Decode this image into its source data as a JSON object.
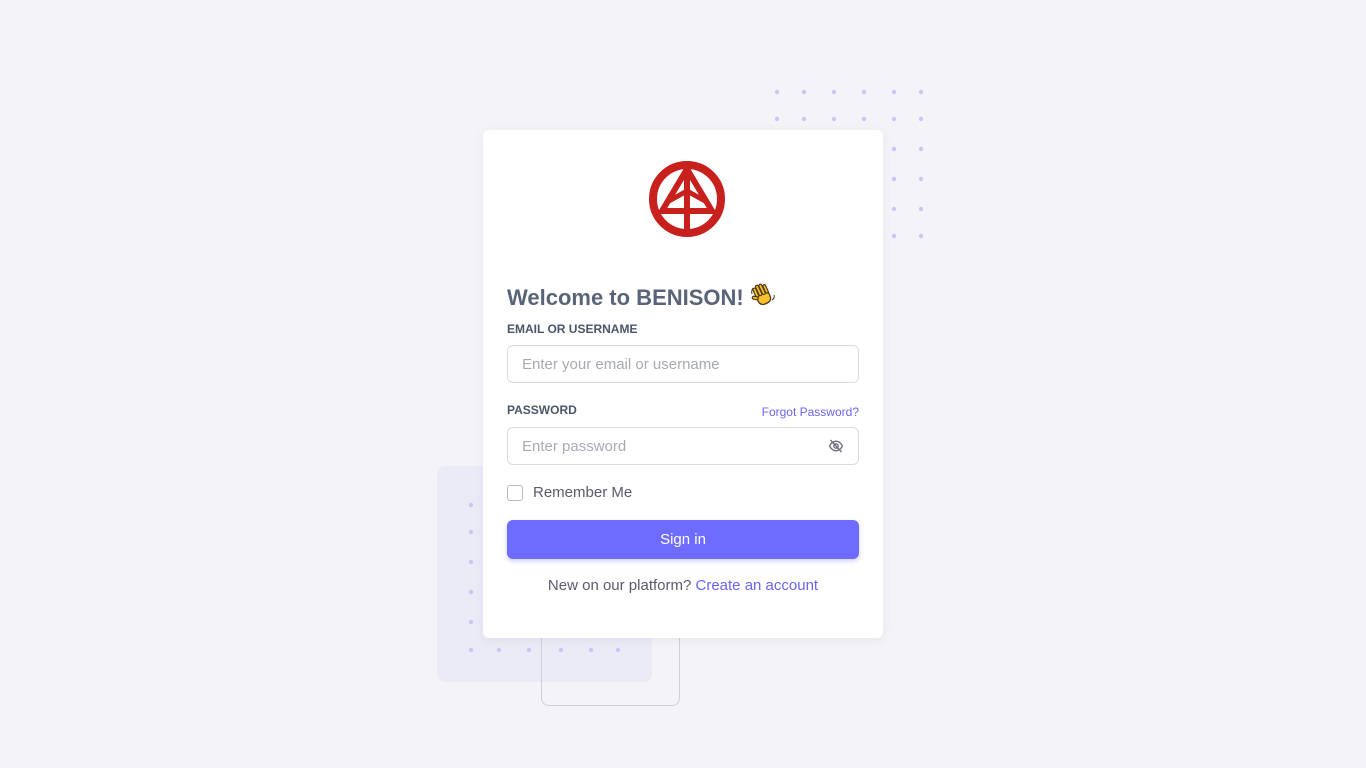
{
  "app": {
    "brand": "BENISON",
    "logo_icon": "benison-logo-icon",
    "colors": {
      "accent": "#6e6bff",
      "link": "#6a64f1",
      "logo_red": "#c8201c",
      "background": "#f4f4f8",
      "dots": "#c9c6f7"
    }
  },
  "login": {
    "title": "Welcome to BENISON!",
    "wave_icon": "waving-hand-icon",
    "email": {
      "label": "EMAIL OR USERNAME",
      "placeholder": "Enter your email or username",
      "value": ""
    },
    "password": {
      "label": "PASSWORD",
      "placeholder": "Enter password",
      "value": "",
      "toggle_icon": "eye-off-icon"
    },
    "forgot_link": "Forgot Password?",
    "remember_label": "Remember Me",
    "remember_checked": false,
    "signin_label": "Sign in",
    "new_account_text": "New on our platform?",
    "create_account_link": "Create an account"
  }
}
